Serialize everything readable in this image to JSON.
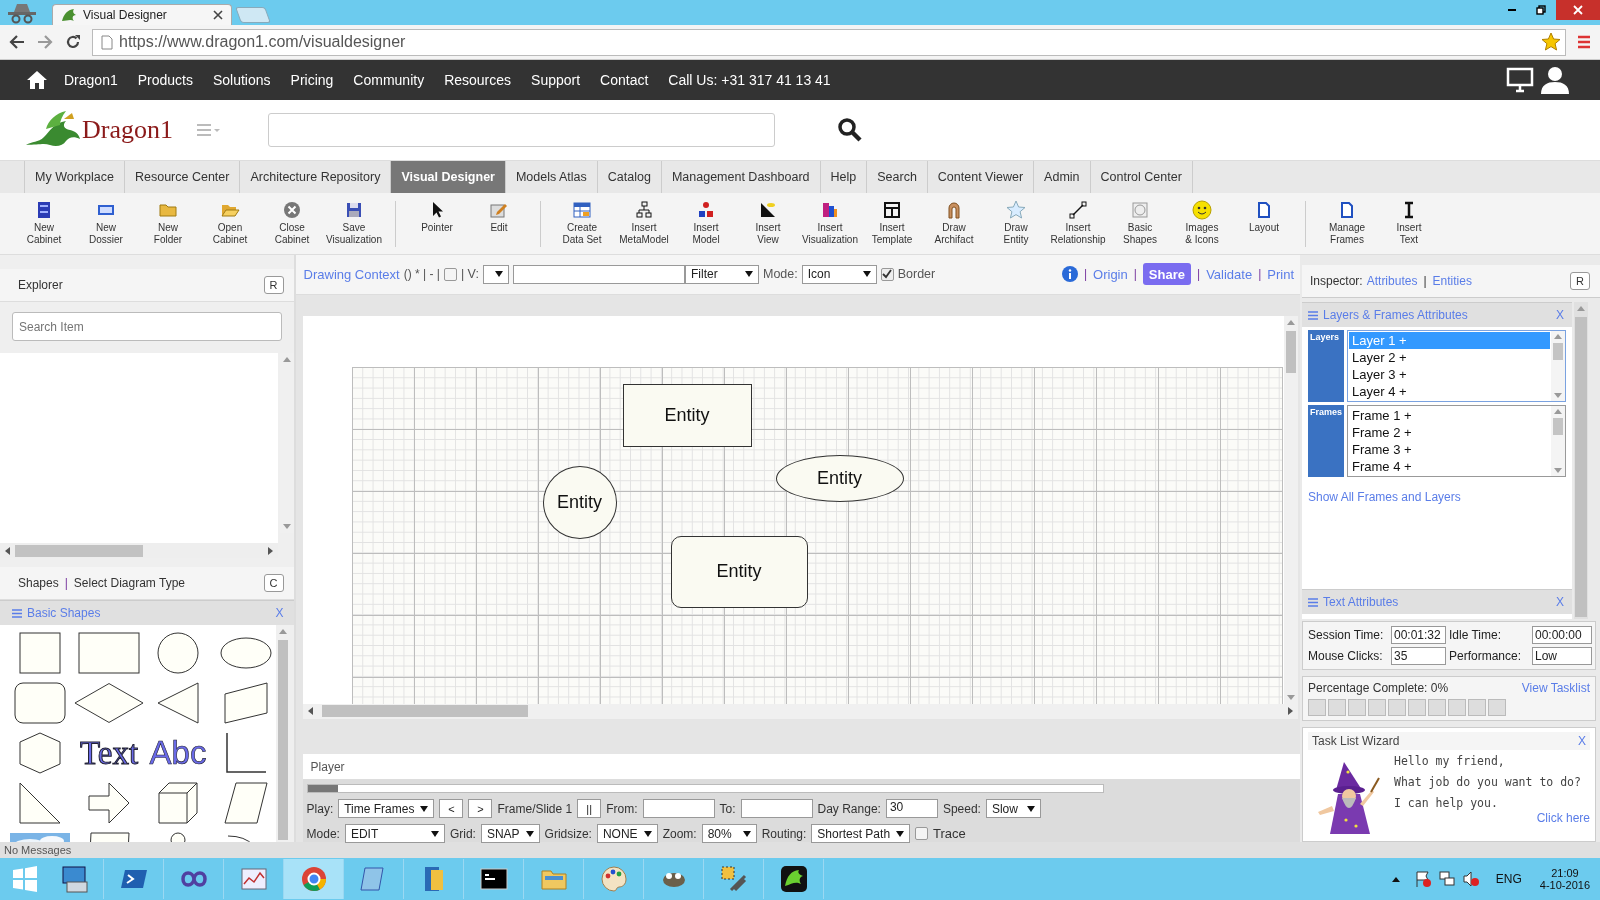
{
  "browser": {
    "tab_title": "Visual Designer",
    "url": "https://www.dragon1.com/visualdesigner"
  },
  "nav": {
    "links": [
      "Dragon1",
      "Products",
      "Solutions",
      "Pricing",
      "Community",
      "Resources",
      "Support",
      "Contact",
      "Call Us: +31 317 41 13 41"
    ]
  },
  "logo": {
    "name": "Dragon1"
  },
  "menu_tabs": [
    {
      "label": "My Workplace",
      "selected": false
    },
    {
      "label": "Resource Center",
      "selected": false
    },
    {
      "label": "Architecture Repository",
      "selected": false
    },
    {
      "label": "Visual Designer",
      "selected": true
    },
    {
      "label": "Models Atlas",
      "selected": false
    },
    {
      "label": "Catalog",
      "selected": false
    },
    {
      "label": "Management Dashboard",
      "selected": false
    },
    {
      "label": "Help",
      "selected": false
    },
    {
      "label": "Search",
      "selected": false
    },
    {
      "label": "Content Viewer",
      "selected": false
    },
    {
      "label": "Admin",
      "selected": false
    },
    {
      "label": "Control Center",
      "selected": false
    }
  ],
  "toolbar": [
    {
      "label": "New\nCabinet",
      "separator_after": false
    },
    {
      "label": "New\nDossier",
      "separator_after": false
    },
    {
      "label": "New\nFolder",
      "separator_after": false
    },
    {
      "label": "Open\nCabinet",
      "separator_after": false
    },
    {
      "label": "Close\nCabinet",
      "separator_after": false
    },
    {
      "label": "Save\nVisualization",
      "separator_after": true
    },
    {
      "label": "Pointer",
      "separator_after": false
    },
    {
      "label": "Edit",
      "separator_after": true
    },
    {
      "label": "Create\nData Set",
      "separator_after": false
    },
    {
      "label": "Insert\nMetaModel",
      "separator_after": false
    },
    {
      "label": "Insert\nModel",
      "separator_after": false
    },
    {
      "label": "Insert\nView",
      "separator_after": false
    },
    {
      "label": "Insert\nVisualization",
      "separator_after": false
    },
    {
      "label": "Insert\nTemplate",
      "separator_after": false
    },
    {
      "label": "Draw\nArchifact",
      "separator_after": false
    },
    {
      "label": "Draw\nEntity",
      "separator_after": false
    },
    {
      "label": "Insert\nRelationship",
      "separator_after": false
    },
    {
      "label": "Basic\nShapes",
      "separator_after": false
    },
    {
      "label": "Images\n& Icons",
      "separator_after": false
    },
    {
      "label": "Layout",
      "separator_after": true
    },
    {
      "label": "Manage\nFrames",
      "separator_after": false
    },
    {
      "label": "Insert\nText",
      "separator_after": false
    }
  ],
  "explorer": {
    "title": "Explorer",
    "button": "R",
    "search_placeholder": "Search Item"
  },
  "shapes_header": {
    "shapes": "Shapes",
    "separator": "|",
    "select": "Select Diagram Type",
    "button": "C"
  },
  "basic_shapes": {
    "title": "Basic Shapes",
    "close": "X",
    "shapes": [
      {
        "kind": "square"
      },
      {
        "kind": "rectangle"
      },
      {
        "kind": "circle"
      },
      {
        "kind": "ellipse"
      },
      {
        "kind": "rounded"
      },
      {
        "kind": "diamond"
      },
      {
        "kind": "triangle"
      },
      {
        "kind": "slanted"
      },
      {
        "kind": "hexagon"
      },
      {
        "kind": "text-serif",
        "text": "Text"
      },
      {
        "kind": "text-sans",
        "text": "Abc"
      },
      {
        "kind": "corner"
      },
      {
        "kind": "right-triangle"
      },
      {
        "kind": "arrow"
      },
      {
        "kind": "cube"
      },
      {
        "kind": "parallelogram"
      },
      {
        "kind": "picture"
      },
      {
        "kind": "document"
      },
      {
        "kind": "actor"
      },
      {
        "kind": "arcs"
      }
    ]
  },
  "context_bar": {
    "title": "Drawing Context",
    "marks": "() * | - |",
    "checked": false,
    "v_label": "| V:",
    "filter": "Filter",
    "mode_label": "Mode:",
    "mode": "Icon",
    "border": {
      "label": "Border",
      "checked": true
    },
    "actions": [
      {
        "kind": "separator",
        "label": "|"
      },
      {
        "kind": "link",
        "label": "Origin"
      },
      {
        "kind": "separator",
        "label": "|"
      },
      {
        "kind": "button",
        "label": "Share"
      },
      {
        "kind": "separator",
        "label": "|"
      },
      {
        "kind": "link",
        "label": "Validate"
      },
      {
        "kind": "separator",
        "label": "|"
      },
      {
        "kind": "link",
        "label": "Print"
      }
    ]
  },
  "canvas": {
    "entities": [
      {
        "kind": "rectangle",
        "label": "Entity"
      },
      {
        "kind": "circle",
        "label": "Entity"
      },
      {
        "kind": "ellipse",
        "label": "Entity"
      },
      {
        "kind": "rounded",
        "label": "Entity"
      }
    ]
  },
  "player": {
    "title": "Player",
    "level": 0,
    "rows": [
      {
        "controls": [
          {
            "kind": "label",
            "text": "Play:"
          },
          {
            "kind": "select",
            "text": "Time Frames"
          },
          {
            "kind": "button",
            "text": "<"
          },
          {
            "kind": "button",
            "text": ">"
          },
          {
            "kind": "label",
            "text": "Frame/Slide 1"
          },
          {
            "kind": "button",
            "text": "||"
          },
          {
            "kind": "label",
            "text": "From:"
          },
          {
            "kind": "input"
          },
          {
            "kind": "label",
            "text": "To:"
          },
          {
            "kind": "input"
          },
          {
            "kind": "label",
            "text": "Day Range:"
          },
          {
            "kind": "input",
            "text": "30"
          },
          {
            "kind": "label",
            "text": "Speed:"
          },
          {
            "kind": "select",
            "text": "Slow"
          }
        ]
      },
      {
        "controls": [
          {
            "kind": "label",
            "text": "Mode:"
          },
          {
            "kind": "select",
            "text": "EDIT"
          },
          {
            "kind": "label",
            "text": "Grid:"
          },
          {
            "kind": "select",
            "text": "SNAP"
          },
          {
            "kind": "label",
            "text": "Gridsize:"
          },
          {
            "kind": "select",
            "text": "NONE"
          },
          {
            "kind": "label",
            "text": "Zoom:"
          },
          {
            "kind": "select",
            "text": "80%"
          },
          {
            "kind": "label",
            "text": "Routing:"
          },
          {
            "kind": "select",
            "text": "Shortest Path"
          },
          {
            "kind": "checkbox",
            "text": "Trace",
            "checked": false
          }
        ]
      }
    ]
  },
  "inspector": {
    "label": "Inspector:",
    "tabs": [
      "Attributes",
      "Entities"
    ],
    "separator": "|",
    "button": "R"
  },
  "layers_frames": {
    "title": "Layers & Frames Attributes",
    "close": "X",
    "layers_label": "Layers",
    "layers": [
      {
        "label": "Layer 1 +",
        "selected": true
      },
      {
        "label": "Layer 2 +",
        "selected": false
      },
      {
        "label": "Layer 3 +",
        "selected": false
      },
      {
        "label": "Layer 4 +",
        "selected": false
      }
    ],
    "frames_label": "Frames",
    "frames": [
      {
        "label": "Frame 1 +",
        "selected": false
      },
      {
        "label": "Frame 2 +",
        "selected": false
      },
      {
        "label": "Frame 3 +",
        "selected": false
      },
      {
        "label": "Frame 4 +",
        "selected": false
      }
    ],
    "link": "Show All Frames and Layers"
  },
  "text_attributes": {
    "title": "Text Attributes",
    "close": "X"
  },
  "session": [
    {
      "label": "Session Time:",
      "value": "00:01:32"
    },
    {
      "label": "Idle Time:",
      "value": "00:00:00"
    },
    {
      "label": "Mouse Clicks:",
      "value": "35"
    },
    {
      "label": "Performance:",
      "value": "Low"
    }
  ],
  "progress": {
    "label": "Percentage Complete: 0%",
    "link": "View Tasklist",
    "level": 0
  },
  "wizard": {
    "title": "Task List Wizard",
    "close": "X",
    "lines": [
      "Hello my friend,",
      "What job do you want to do?",
      "I can help you."
    ],
    "link": "Click here"
  },
  "status": "No Messages",
  "taskbar": {
    "apps": [
      {
        "selected": false
      },
      {
        "selected": false
      },
      {
        "selected": false
      },
      {
        "selected": false
      },
      {
        "selected": true
      },
      {
        "selected": false
      },
      {
        "selected": false
      },
      {
        "selected": false
      },
      {
        "selected": false
      },
      {
        "selected": false
      },
      {
        "selected": false
      },
      {
        "selected": false
      },
      {
        "selected": false
      }
    ],
    "language": "ENG",
    "time": "21:09",
    "date": "4-10-2016"
  }
}
